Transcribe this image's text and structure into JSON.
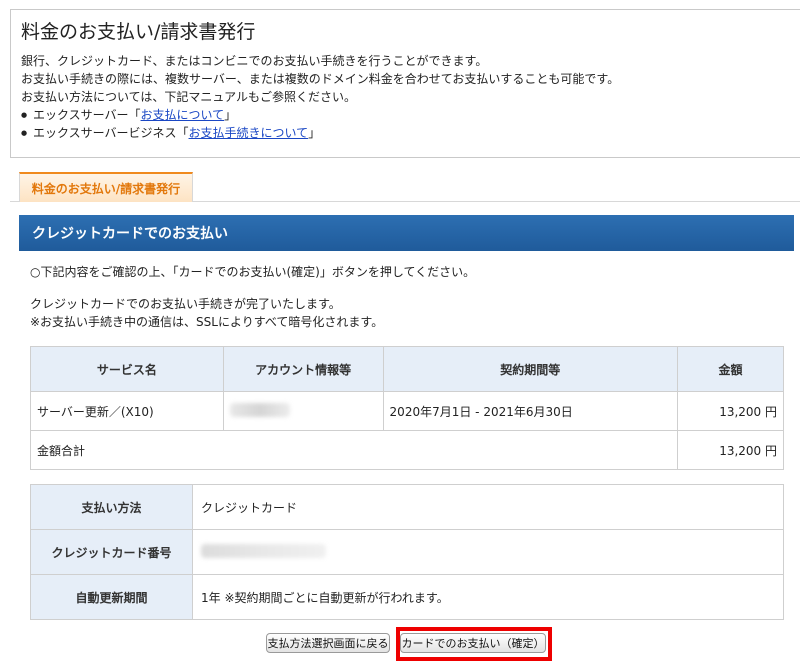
{
  "intro": {
    "title": "料金のお支払い/請求書発行",
    "lines": [
      "銀行、クレジットカード、またはコンビニでのお支払い手続きを行うことができます。",
      "お支払い手続きの際には、複数サーバー、または複数のドメイン料金を合わせてお支払いすることも可能です。",
      "お支払い方法については、下記マニュアルもご参照ください。"
    ],
    "links": [
      {
        "prefix": "エックスサーバー「",
        "link": "お支払について",
        "suffix": "」"
      },
      {
        "prefix": "エックスサーバービジネス「",
        "link": "お支払手続きについて",
        "suffix": "」"
      }
    ]
  },
  "tab": {
    "label": "料金のお支払い/請求書発行"
  },
  "section": {
    "title": "クレジットカードでのお支払い"
  },
  "messages": {
    "instruction": "○下記内容をご確認の上、「カードでのお支払い(確定)」ボタンを押してください。",
    "complete": "クレジットカードでのお支払い手続きが完了いたします。",
    "ssl": "※お支払い手続き中の通信は、SSLによりすべて暗号化されます。"
  },
  "service_table": {
    "headers": [
      "サービス名",
      "アカウント情報等",
      "契約期間等",
      "金額"
    ],
    "row": {
      "service": "サーバー更新／(X10)",
      "period": "2020年7月1日 - 2021年6月30日",
      "amount": "13,200 円"
    },
    "total_label": "金額合計",
    "total_amount": "13,200 円"
  },
  "payment_table": {
    "method_label": "支払い方法",
    "method_value": "クレジットカード",
    "card_label": "クレジットカード番号",
    "renew_label": "自動更新期間",
    "renew_value": "1年 ※契約期間ごとに自動更新が行われます。"
  },
  "buttons": {
    "back": "支払方法選択画面に戻る",
    "confirm": "カードでのお支払い（確定）"
  },
  "colors": {
    "accent": "#f08a1e",
    "header_blue": "#1f5b9b",
    "highlight": "#ee0000",
    "link": "#1a47c4"
  }
}
